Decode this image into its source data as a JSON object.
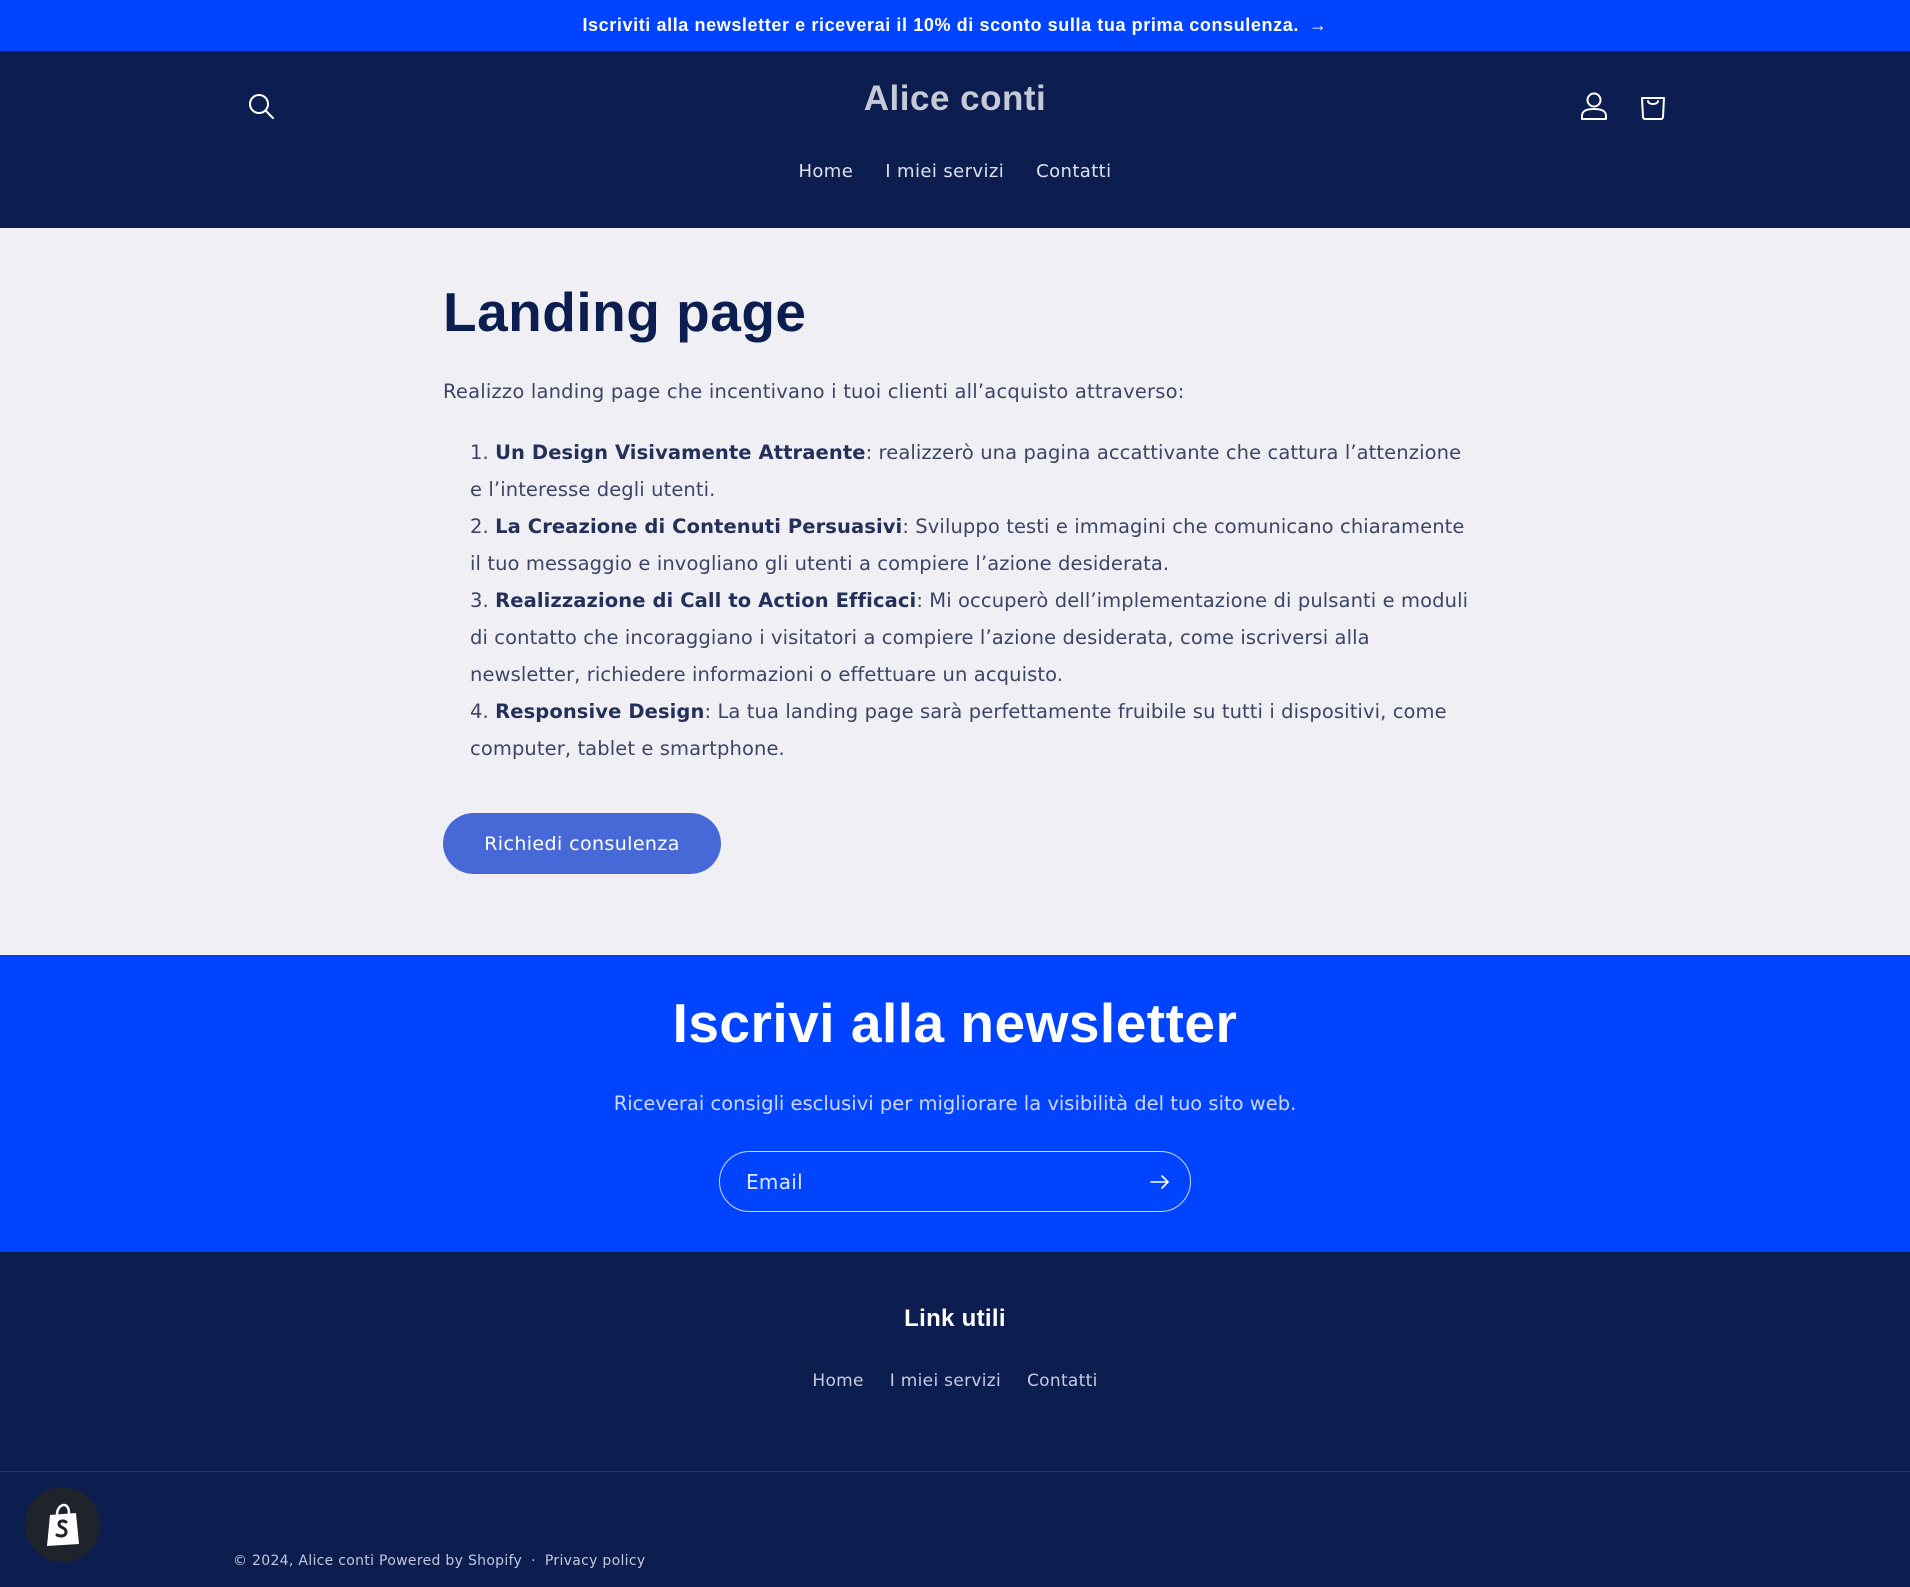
{
  "announcement": {
    "text": "Iscriviti alla newsletter e riceverai il 10% di sconto sulla tua prima consulenza.",
    "arrow": "→"
  },
  "header": {
    "logo": "Alice conti",
    "nav": [
      {
        "label": "Home"
      },
      {
        "label": "I miei servizi"
      },
      {
        "label": "Contatti"
      }
    ]
  },
  "main": {
    "title": "Landing page",
    "intro": "Realizzo landing page che incentivano i tuoi clienti all’acquisto attraverso:",
    "items": [
      {
        "num": "1.",
        "bold": "Un Design Visivamente Attraente",
        "text": ": realizzerò una pagina accattivante che cattura l’attenzione e l’interesse degli utenti."
      },
      {
        "num": "2.",
        "bold": "La Creazione di Contenuti Persuasivi",
        "text": ": Sviluppo testi e immagini che comunicano chiaramente il tuo messaggio e invogliano gli utenti a compiere l’azione desiderata."
      },
      {
        "num": "3.",
        "bold": "Realizzazione di Call to Action Efficaci",
        "text": ": Mi occuperò dell’implementazione di pulsanti e moduli di contatto che incoraggiano i visitatori a compiere l’azione desiderata, come iscriversi alla newsletter, richiedere informazioni o effettuare un acquisto."
      },
      {
        "num": "4.",
        "bold": "Responsive Design",
        "text": ": La tua landing page sarà perfettamente fruibile su tutti i dispositivi, come computer, tablet e smartphone."
      }
    ],
    "cta_label": "Richiedi consulenza"
  },
  "newsletter": {
    "title": "Iscrivi alla newsletter",
    "subtitle": "Riceverai consigli esclusivi per migliorare la visibilità del tuo sito web.",
    "email_placeholder": "Email"
  },
  "footer": {
    "heading": "Link utili",
    "links": [
      {
        "label": "Home"
      },
      {
        "label": "I miei servizi"
      },
      {
        "label": "Contatti"
      }
    ],
    "copyright": "© 2024, Alice conti Powered by Shopify",
    "dot": "·",
    "privacy": "Privacy policy"
  },
  "colors": {
    "accent_blue": "#0044ff",
    "navy": "#0c1d4f",
    "button_blue": "#4669d7",
    "page_bg": "#efeff4"
  },
  "icons": [
    "search-icon",
    "account-icon",
    "cart-icon",
    "arrow-right-icon",
    "shopify-bag-icon"
  ]
}
